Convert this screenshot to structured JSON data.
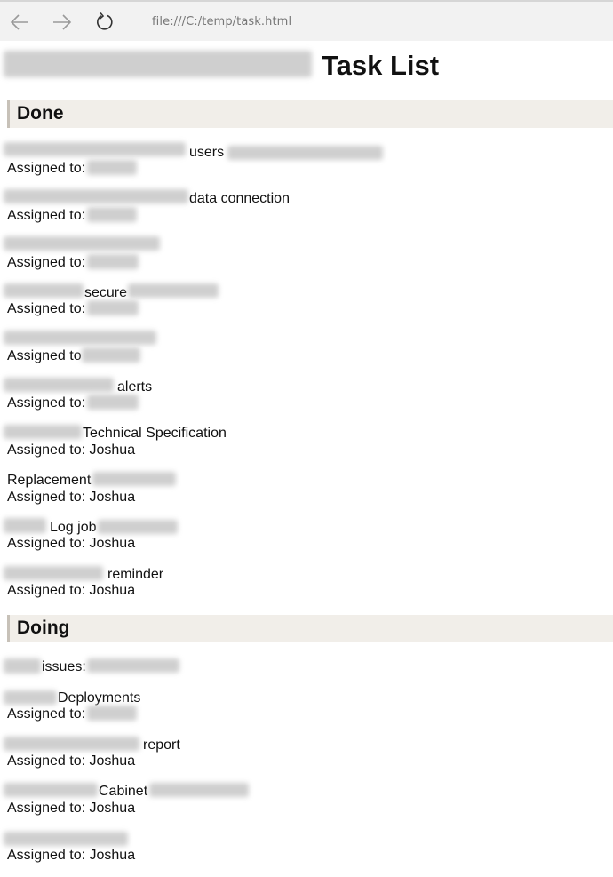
{
  "browser": {
    "url": "file:///C:/temp/task.html",
    "back_icon": "arrow-left-icon",
    "forward_icon": "arrow-right-icon",
    "refresh_icon": "refresh-icon"
  },
  "page": {
    "title": "Task List"
  },
  "sections": [
    {
      "label": "Done",
      "tasks": [
        {
          "text": "users",
          "assigned": "Assigned to:"
        },
        {
          "text": "data connection",
          "assigned": "Assigned to:"
        },
        {
          "text": "",
          "assigned": "Assigned to:"
        },
        {
          "text": "secure",
          "assigned": "Assigned to:"
        },
        {
          "text": "",
          "assigned": "Assigned to"
        },
        {
          "text": "alerts",
          "assigned": "Assigned to:"
        },
        {
          "text": "Technical Specification",
          "assigned": "Assigned to: Joshua"
        },
        {
          "text": "Replacement",
          "assigned": "Assigned to: Joshua"
        },
        {
          "text": "Log job",
          "assigned": "Assigned to: Joshua"
        },
        {
          "text": "reminder",
          "assigned": "Assigned to: Joshua"
        }
      ]
    },
    {
      "label": "Doing",
      "tasks": [
        {
          "text": "issues:",
          "assigned": ""
        },
        {
          "text": "Deployments",
          "assigned": "Assigned to:"
        },
        {
          "text": "report",
          "assigned": "Assigned to: Joshua"
        },
        {
          "text": "Cabinet",
          "assigned": "Assigned to: Joshua"
        },
        {
          "text": "",
          "assigned": "Assigned to: Joshua"
        }
      ]
    }
  ]
}
